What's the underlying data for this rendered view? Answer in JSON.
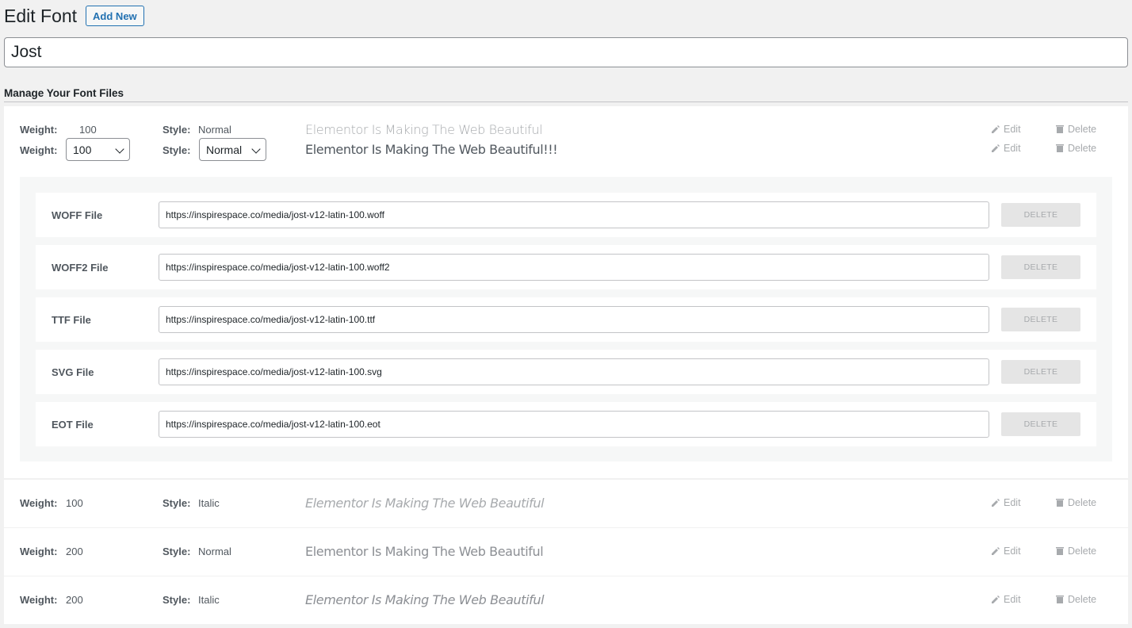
{
  "header": {
    "title": "Edit Font",
    "add_new_label": "Add New"
  },
  "font_name": {
    "value": "Jost"
  },
  "section": {
    "title": "Manage Your Font Files"
  },
  "labels": {
    "weight": "Weight:",
    "style": "Style:",
    "edit": "Edit",
    "delete": "Delete"
  },
  "open_variant": {
    "weight": "100",
    "style": "Normal",
    "preview": "Elementor Is Making The Web Beautiful",
    "edit_weight": "100",
    "edit_style": "Normal",
    "edit_preview": "Elementor Is Making The Web Beautiful!!!",
    "files": [
      {
        "label": "WOFF File",
        "url": "https://inspirespace.co/media/jost-v12-latin-100.woff",
        "delete_label": "DELETE"
      },
      {
        "label": "WOFF2 File",
        "url": "https://inspirespace.co/media/jost-v12-latin-100.woff2",
        "delete_label": "DELETE"
      },
      {
        "label": "TTF File",
        "url": "https://inspirespace.co/media/jost-v12-latin-100.ttf",
        "delete_label": "DELETE"
      },
      {
        "label": "SVG File",
        "url": "https://inspirespace.co/media/jost-v12-latin-100.svg",
        "delete_label": "DELETE"
      },
      {
        "label": "EOT File",
        "url": "https://inspirespace.co/media/jost-v12-latin-100.eot",
        "delete_label": "DELETE"
      }
    ]
  },
  "variants": [
    {
      "weight": "100",
      "style": "Italic",
      "preview": "Elementor Is Making The Web Beautiful"
    },
    {
      "weight": "200",
      "style": "Normal",
      "preview": "Elementor Is Making The Web Beautiful"
    },
    {
      "weight": "200",
      "style": "Italic",
      "preview": "Elementor Is Making The Web Beautiful"
    }
  ],
  "icons": {
    "edit": "pencil-icon",
    "delete": "trash-icon",
    "dropdown": "chevron-down-icon"
  },
  "colors": {
    "accent": "#2271b1",
    "muted": "#a7aaad"
  }
}
